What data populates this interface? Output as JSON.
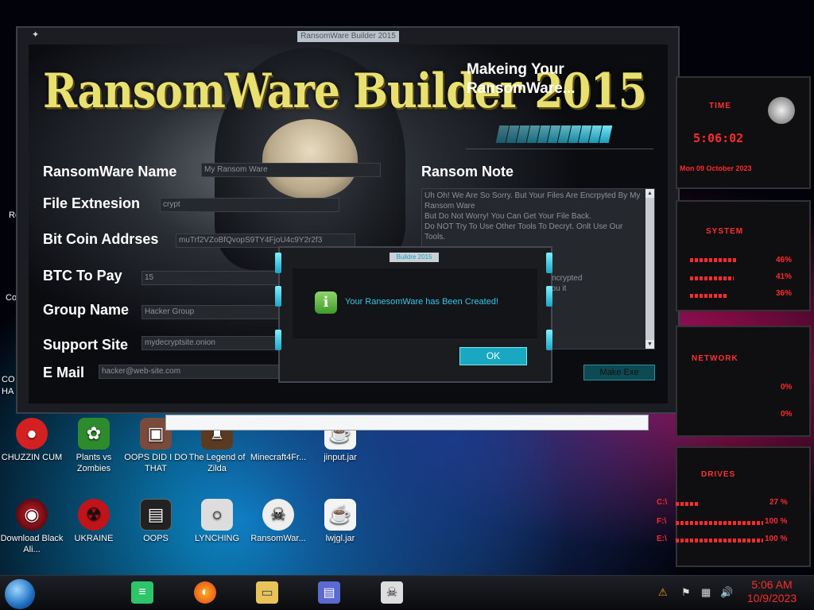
{
  "window": {
    "title": "RansomWare Builder 2015",
    "logo_text": "RansomWare Builder 2015",
    "heading": [
      "Makeing Your",
      "RansomWare..."
    ],
    "progress_fraction": 0.75,
    "fields": {
      "name_label": "RansomWare Name",
      "name_value": "My Ransom Ware",
      "ext_label": "File Extnesion",
      "ext_value": "crypt",
      "btc_label": "Bit Coin Addrses",
      "btc_value": "muTrf2VZoBfQvopS9TY4FjoU4c9Y2r2f3",
      "pay_label": "BTC To Pay",
      "pay_value": "15",
      "group_label": "Group Name",
      "group_value": "Hacker Group",
      "site_label": "Support Site",
      "site_value": "mydecryptsite.onion",
      "email_label": "E Mail",
      "email_value": "hacker@web-site.com"
    },
    "note_label": "Ransom Note",
    "note_text": "Uh Oh! We Are So Sorry. But Your Files Are Encrpyted By My Ransom Ware\nBut Do Not Worry! You Can Get Your File Back.\nDo NOT Try To Use Other Tools To Decryt. Onlt Use Our Tools.\n\n                                   ss:\n                                   Y2r2f3\n                                   ? Send One Encrypted\n                                   we will send You it\n\n                                   on\n                                   ker Group",
    "make_button": "Make Exe"
  },
  "dialog": {
    "title": "Buildre 2015",
    "message": "Your RanesomWare has Been Created!",
    "ok_label": "OK",
    "icon": "info-icon"
  },
  "desktop": {
    "icons": [
      {
        "label": "CHUZZIN CUM",
        "icon": "chuzzle-icon"
      },
      {
        "label": "Plants vs Zombies",
        "icon": "plant-icon"
      },
      {
        "label": "OOPS DID I DO THAT",
        "icon": "photo-icon"
      },
      {
        "label": "The Legend of Zilda",
        "icon": "game-icon"
      },
      {
        "label": "Minecraft4Fr...",
        "icon": "minecraft-icon"
      },
      {
        "label": "jinput.jar",
        "icon": "java-icon"
      },
      {
        "label": "Download Black Ali...",
        "icon": "alienware-icon"
      },
      {
        "label": "UKRAINE",
        "icon": "radiation-icon"
      },
      {
        "label": "OOPS",
        "icon": "shortcut-icon"
      },
      {
        "label": "LYNCHING",
        "icon": "noose-icon"
      },
      {
        "label": "RansomWar...",
        "icon": "skull-icon"
      },
      {
        "label": "lwjgl.jar",
        "icon": "java-icon"
      }
    ],
    "left_edge_labels": [
      "Re",
      "Co",
      "CO",
      "HA"
    ]
  },
  "gadgets": {
    "time_title": "Time",
    "time_value": "5:06:02",
    "date_value": "Mon 09 October 2023",
    "system_title": "System",
    "system_values": [
      "46%",
      "41%",
      "36%"
    ],
    "network_title": "Network",
    "network_values": [
      "0%",
      "0%"
    ],
    "drives_title": "Drives",
    "drives": [
      {
        "label": "C:\\",
        "value": "27 %"
      },
      {
        "label": "F:\\",
        "value": "100 %"
      },
      {
        "label": "E:\\",
        "value": "100 %"
      }
    ]
  },
  "taskbar": {
    "time": "5:06 AM",
    "date": "10/9/2023"
  },
  "colors": {
    "accent": "#19a8c2",
    "gadget_red": "#ff2a2a"
  }
}
